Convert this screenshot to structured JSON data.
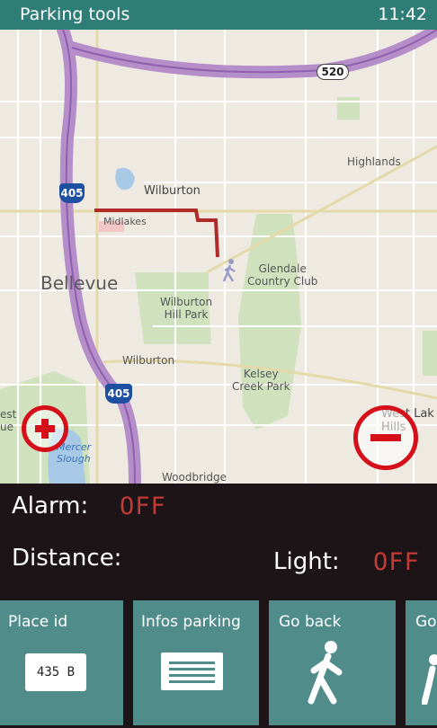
{
  "status_bar": {
    "app_title": "Parking tools",
    "time": "11:42"
  },
  "map": {
    "labels": {
      "wilburton_top": "Wilburton",
      "midlakes": "Midlakes",
      "highlands": "Highlands",
      "bellevue": "Bellevue",
      "glendale": "Glendale\nCountry Club",
      "wilburton_hill_park": "Wilburton\nHill Park",
      "wilburton_bottom": "Wilburton",
      "kelsey_creek": "Kelsey\nCreek Park",
      "west_left": "est\nue",
      "west_lake_hills": "West Lak\nHills",
      "mercer_slough": "Mercer\nSlough",
      "woodbridge": "Woodbridge"
    },
    "shields": {
      "i405_top": "405",
      "sr520": "520",
      "i405_bottom": "405"
    },
    "colors": {
      "route": "#b02a2a",
      "highway": "#b58ec9",
      "park": "#cfe2bd",
      "water": "#a8c9e6"
    }
  },
  "zoom": {
    "in_icon": "plus-icon",
    "out_icon": "minus-icon",
    "color": "#d5101a"
  },
  "info": {
    "alarm_label": "Alarm:",
    "alarm_value": "OFF",
    "distance_label": "Distance:",
    "light_label": "Light:",
    "light_value": "OFF"
  },
  "tiles": [
    {
      "label": "Place id",
      "plate": "435 B",
      "icon": "license-plate-icon"
    },
    {
      "label": "Infos parking",
      "icon": "document-icon"
    },
    {
      "label": "Go back",
      "icon": "walking-person-icon"
    },
    {
      "label": "Go",
      "icon": "walking-person-icon"
    }
  ]
}
